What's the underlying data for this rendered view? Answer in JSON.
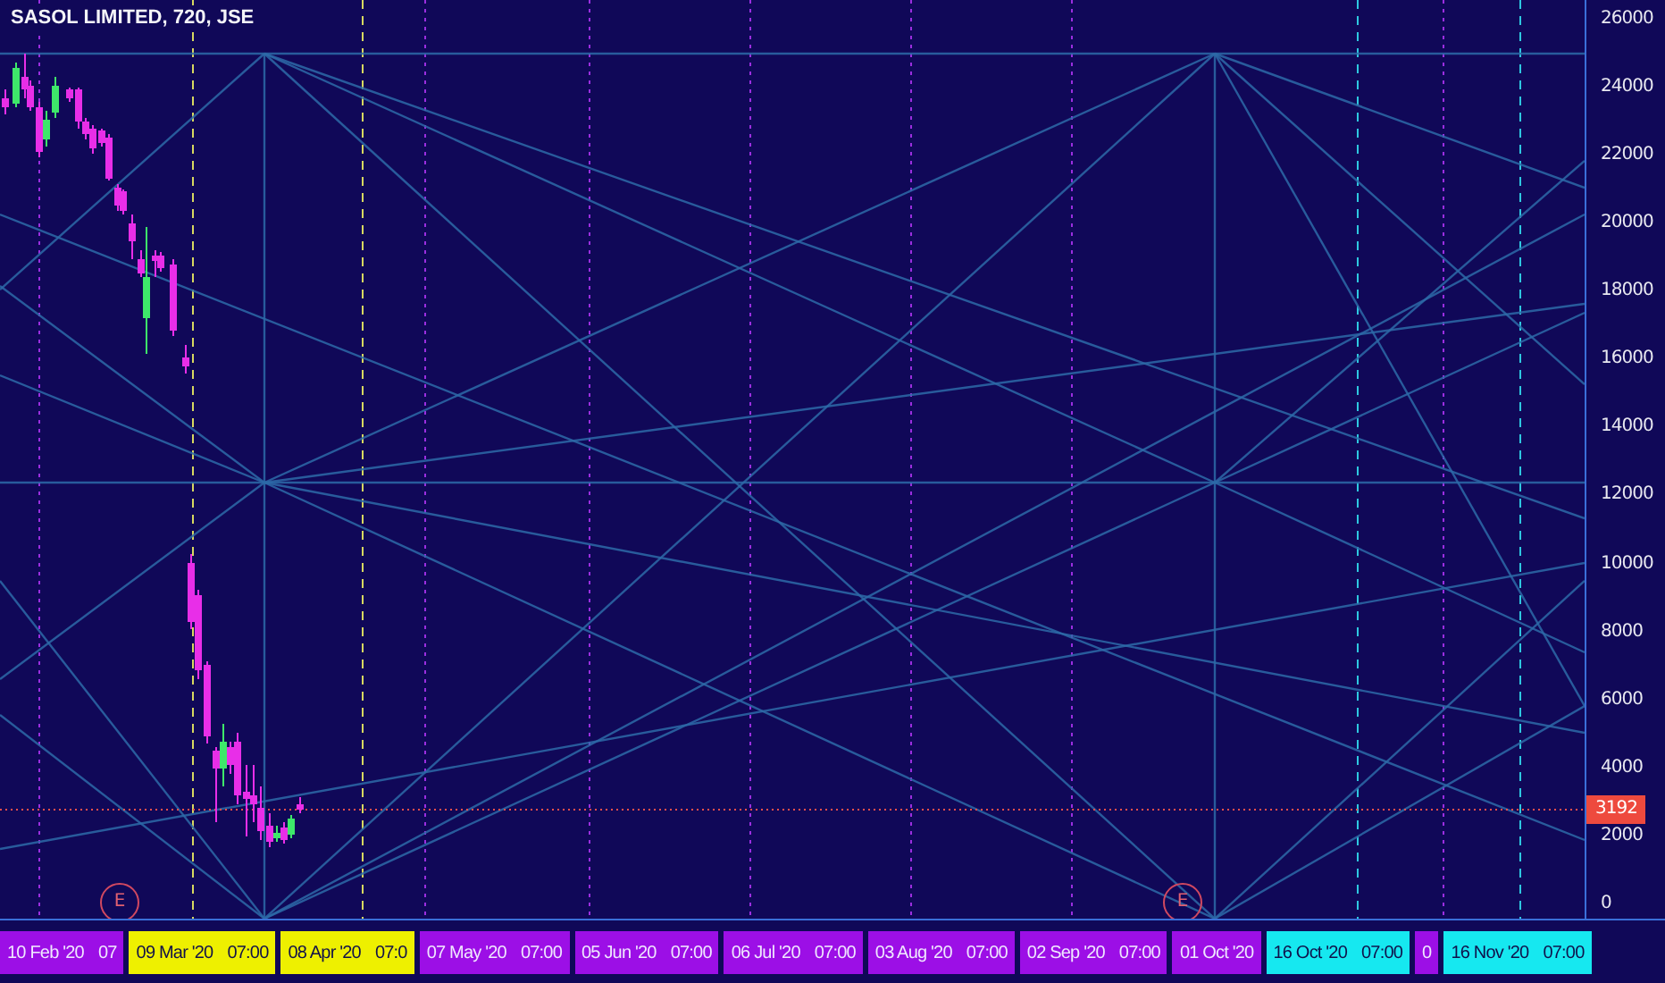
{
  "title": "SASOL LIMITED, 720, JSE",
  "price_scale": {
    "labels": [
      "26000",
      "24000",
      "22000",
      "20000",
      "18000",
      "16000",
      "14000",
      "12000",
      "10000",
      "8000",
      "6000",
      "4000",
      "2000",
      "0"
    ],
    "last_price": "3192"
  },
  "earnings_markers": [
    "E",
    "E"
  ],
  "time_scale": [
    {
      "date": "10 Feb '20",
      "time": "07",
      "color": "#9c0fe6"
    },
    {
      "date": "09 Mar '20",
      "time": "07:00",
      "color": "#eef000"
    },
    {
      "date": "08 Apr '20",
      "time": "07:0",
      "color": "#eef000"
    },
    {
      "date": "07 May '20",
      "time": "07:00",
      "color": "#9c0fe6"
    },
    {
      "date": "05 Jun '20",
      "time": "07:00",
      "color": "#9c0fe6"
    },
    {
      "date": "06 Jul '20",
      "time": "07:00",
      "color": "#9c0fe6"
    },
    {
      "date": "03 Aug '20",
      "time": "07:00",
      "color": "#9c0fe6"
    },
    {
      "date": "02 Sep '20",
      "time": "07:00",
      "color": "#9c0fe6"
    },
    {
      "date": "01 Oct '20",
      "color": "#9c0fe6"
    },
    {
      "date": "16 Oct '20",
      "time": "07:00",
      "color": "#16e8f0"
    },
    {
      "date": "0",
      "color": "#9c0fe6"
    },
    {
      "date": "16 Nov '20",
      "time": "07:00",
      "color": "#16e8f0"
    }
  ]
}
